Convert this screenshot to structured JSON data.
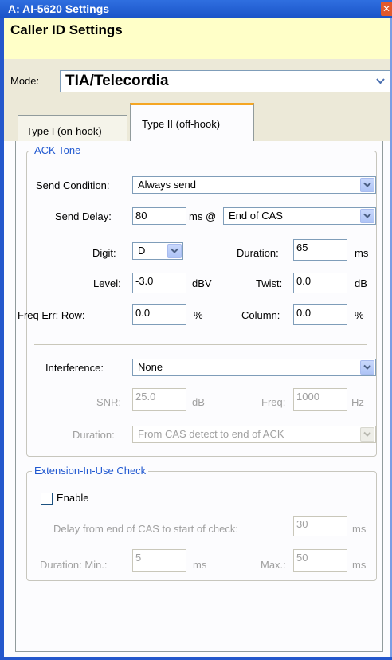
{
  "window": {
    "title": "A: AI-5620 Settings"
  },
  "header": {
    "title": "Caller ID Settings"
  },
  "mode": {
    "label": "Mode:",
    "value": "TIA/Telecordia"
  },
  "tabs": [
    {
      "label": "Type I (on-hook)",
      "selected": false
    },
    {
      "label": "Type II (off-hook)",
      "selected": true
    }
  ],
  "ack_tone": {
    "title": "ACK Tone",
    "send_condition": {
      "label": "Send Condition:",
      "value": "Always send"
    },
    "send_delay": {
      "label": "Send Delay:",
      "value": "80",
      "unit": "ms @",
      "ref": "End of CAS"
    },
    "digit": {
      "label": "Digit:",
      "value": "D"
    },
    "duration": {
      "label": "Duration:",
      "value": "65",
      "unit": "ms"
    },
    "level": {
      "label": "Level:",
      "value": "-3.0",
      "unit": "dBV"
    },
    "twist": {
      "label": "Twist:",
      "value": "0.0",
      "unit": "dB"
    },
    "freq_err_row": {
      "label": "Freq Err:  Row:",
      "value": "0.0",
      "unit": "%"
    },
    "column": {
      "label": "Column:",
      "value": "0.0",
      "unit": "%"
    },
    "interference": {
      "label": "Interference:",
      "value": "None"
    },
    "snr": {
      "label": "SNR:",
      "value": "25.0",
      "unit": "dB"
    },
    "freq": {
      "label": "Freq:",
      "value": "1000",
      "unit": "Hz"
    },
    "int_duration": {
      "label": "Duration:",
      "value": "From CAS detect to end of ACK"
    }
  },
  "extension": {
    "title": "Extension-In-Use Check",
    "enable_label": "Enable",
    "enabled": false,
    "delay": {
      "label": "Delay from end of CAS to start of check:",
      "value": "30",
      "unit": "ms"
    },
    "min": {
      "label": "Duration:  Min.:",
      "value": "5",
      "unit": "ms"
    },
    "max": {
      "label": "Max.:",
      "value": "50",
      "unit": "ms"
    }
  },
  "colors": {
    "titlebar": "#1b54c8",
    "header_bg": "#ffffc8",
    "group_title": "#2058d0",
    "tab_accent": "#f5a623"
  }
}
